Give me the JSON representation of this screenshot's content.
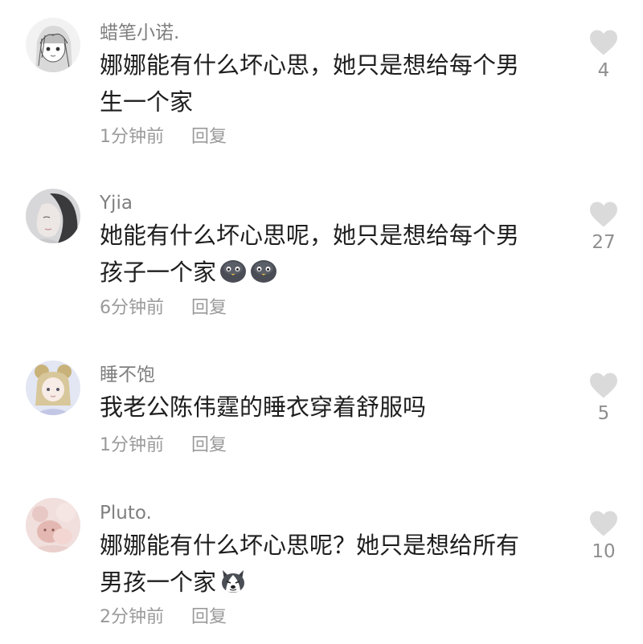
{
  "comments": [
    {
      "username": "蜡笔小诺.",
      "line1": "娜娜能有什么坏心思，她只是想给每个男",
      "line2": "生一个家",
      "time": "1分钟前",
      "reply": "回复",
      "likes": "4"
    },
    {
      "username": "Yjia",
      "line1": "她能有什么坏心思呢，她只是想给每个男",
      "line2": "孩子一个家",
      "time": "6分钟前",
      "reply": "回复",
      "likes": "27"
    },
    {
      "username": "睡不饱",
      "line1": "我老公陈伟霆的睡衣穿着舒服吗",
      "time": "1分钟前",
      "reply": "回复",
      "likes": "5"
    },
    {
      "username": "Pluto.",
      "line1": "娜娜能有什么坏心思呢？她只是想给所有",
      "line2": "男孩一个家",
      "time": "2分钟前",
      "reply": "回复",
      "likes": "10"
    }
  ],
  "icons": [
    "heart-icon",
    "sad-blob-emoji-icon",
    "husky-dog-emoji-icon"
  ]
}
